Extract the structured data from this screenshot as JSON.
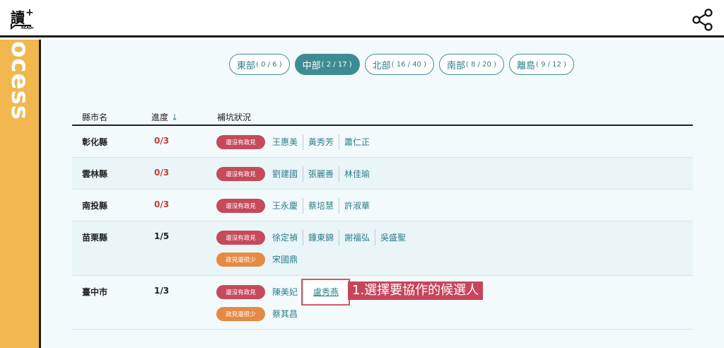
{
  "header": {
    "logo_text": "讀+",
    "logo_sub": "READr"
  },
  "sidebar": {
    "label": "ocess"
  },
  "regions": [
    {
      "name": "東部",
      "count": "( 0 / 6 )",
      "active": false
    },
    {
      "name": "中部",
      "count": "( 2 / 17 )",
      "active": true
    },
    {
      "name": "北部",
      "count": "( 16 / 40 )",
      "active": false
    },
    {
      "name": "南部",
      "count": "( 8 / 20 )",
      "active": false
    },
    {
      "name": "離島",
      "count": "( 9 / 12 )",
      "active": false
    }
  ],
  "table": {
    "headers": {
      "county": "縣市名",
      "progress": "進度",
      "progress_arrow": "↓",
      "status": "補坑狀況"
    },
    "rows": [
      {
        "county": "彰化縣",
        "progress": "0/3",
        "status_lines": [
          {
            "badge": "還沒有政見",
            "candidates": [
              "王惠美",
              "黃秀芳",
              "蕭仁正"
            ]
          }
        ]
      },
      {
        "county": "雲林縣",
        "progress": "0/3",
        "status_lines": [
          {
            "badge": "還沒有政見",
            "candidates": [
              "劉建國",
              "張麗善",
              "林佳瑜"
            ]
          }
        ]
      },
      {
        "county": "南投縣",
        "progress": "0/3",
        "status_lines": [
          {
            "badge": "還沒有政見",
            "candidates": [
              "王永慶",
              "蔡培慧",
              "許淑華"
            ]
          }
        ]
      },
      {
        "county": "苗栗縣",
        "progress": "1/5",
        "status_lines": [
          {
            "badge": "還沒有政見",
            "candidates": [
              "徐定禎",
              "鍾東錦",
              "謝福弘",
              "吳盛聖"
            ]
          },
          {
            "badge": "政見還很少",
            "candidates": [
              "宋國鼎"
            ]
          }
        ]
      },
      {
        "county": "臺中市",
        "progress": "1/3",
        "status_lines": [
          {
            "badge": "還沒有政見",
            "candidates": [
              "陳美妃",
              "盧秀燕"
            ]
          },
          {
            "badge": "政見還很少",
            "candidates": [
              "蔡其昌"
            ]
          }
        ]
      }
    ]
  },
  "annotation": {
    "text": "1.選擇要協作的候選人"
  },
  "colors": {
    "accent": "#3e8c93",
    "badge_none": "#c54a5c",
    "badge_few": "#e58a45",
    "sidebar": "#f0b84e"
  }
}
